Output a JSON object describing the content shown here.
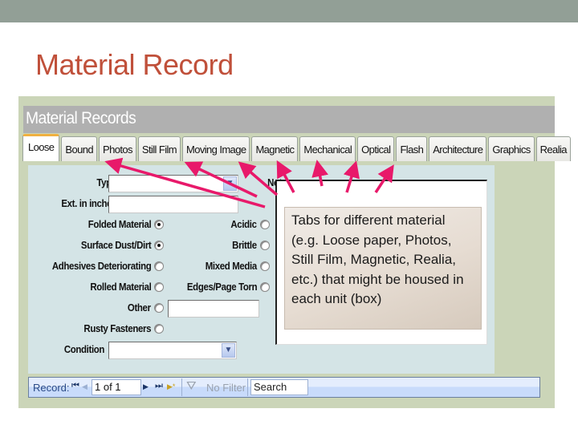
{
  "slide": {
    "title": "Material Record"
  },
  "form": {
    "header_title": "Material Records",
    "tabs": [
      {
        "label": "Loose",
        "active": true
      },
      {
        "label": "Bound",
        "active": false
      },
      {
        "label": "Photos",
        "active": false
      },
      {
        "label": "Still Film",
        "active": false
      },
      {
        "label": "Moving Image",
        "active": false
      },
      {
        "label": "Magnetic",
        "active": false
      },
      {
        "label": "Mechanical",
        "active": false
      },
      {
        "label": "Optical",
        "active": false
      },
      {
        "label": "Flash",
        "active": false
      },
      {
        "label": "Architecture",
        "active": false
      },
      {
        "label": "Graphics",
        "active": false
      },
      {
        "label": "Realia",
        "active": false
      }
    ],
    "fields": {
      "type_label": "Type",
      "type_value": "",
      "ext_label": "Ext. in inches",
      "ext_value": "",
      "notes_label": "Notes",
      "notes_value": "",
      "other_text_value": "",
      "condition_label": "Condition",
      "condition_value": ""
    },
    "checks": {
      "folded_material": {
        "label": "Folded Material",
        "checked": true
      },
      "surface_dust": {
        "label": "Surface Dust/Dirt",
        "checked": true
      },
      "adhesives": {
        "label": "Adhesives Deteriorating",
        "checked": false
      },
      "rolled_material": {
        "label": "Rolled Material",
        "checked": false
      },
      "other": {
        "label": "Other",
        "checked": false
      },
      "rusty_fasteners": {
        "label": "Rusty Fasteners",
        "checked": false
      },
      "acidic": {
        "label": "Acidic",
        "checked": false
      },
      "brittle": {
        "label": "Brittle",
        "checked": false
      },
      "mixed_media": {
        "label": "Mixed Media",
        "checked": false
      },
      "edges_torn": {
        "label": "Edges/Page Torn",
        "checked": false
      }
    },
    "navbar": {
      "record_label": "Record:",
      "first_icon": "⏮",
      "prev_icon": "◀",
      "record_position": "1 of 1",
      "next_icon": "▶",
      "last_icon": "⏭",
      "new_icon": "▶*",
      "filter_icon": "⛛",
      "filter_label": "No Filter",
      "search_placeholder": "Search"
    }
  },
  "callout": {
    "text": "Tabs for different material (e.g. Loose paper, Photos, Still Film, Magnetic, Realia, etc.) that might be housed in each unit (box)",
    "arrow_color": "#e8196a"
  }
}
